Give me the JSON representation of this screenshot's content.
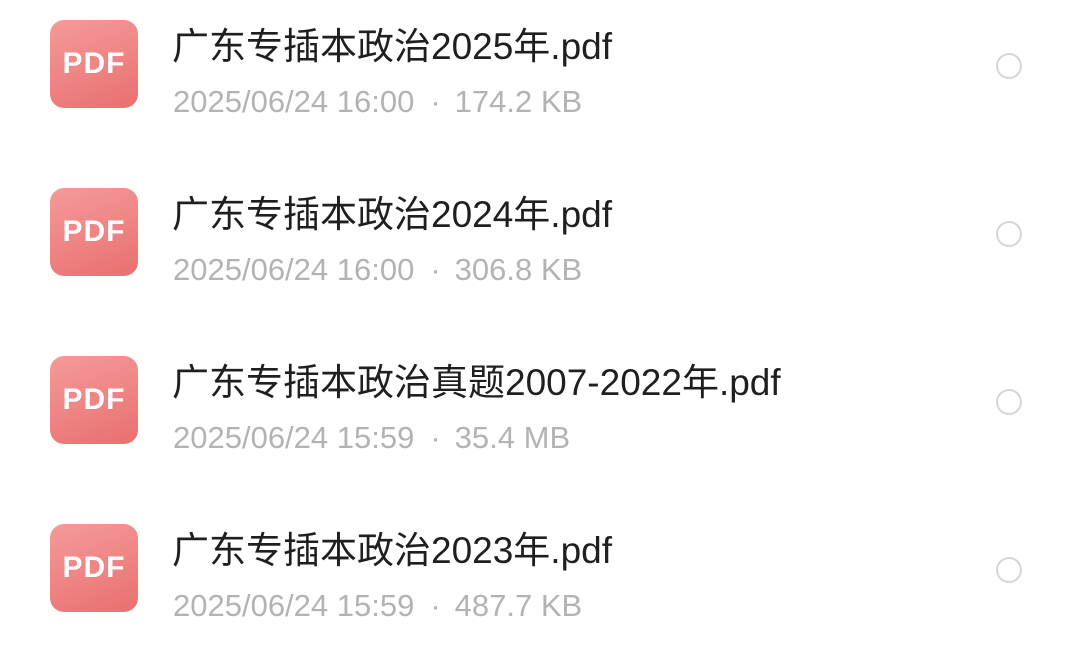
{
  "icon_badge": "PDF",
  "meta_separator": "·",
  "colors": {
    "pdf_icon": "#ef8383",
    "title_text": "#1f1f1f",
    "meta_text": "#b3b3b3",
    "radio_border": "#d6d6d6"
  },
  "files": [
    {
      "name": "广东专插本政治2025年.pdf",
      "date": "2025/06/24 16:00",
      "size": "174.2 KB",
      "icon": "pdf-file-icon",
      "selected": false
    },
    {
      "name": "广东专插本政治2024年.pdf",
      "date": "2025/06/24 16:00",
      "size": "306.8 KB",
      "icon": "pdf-file-icon",
      "selected": false
    },
    {
      "name": "广东专插本政治真题2007-2022年.pdf",
      "date": "2025/06/24 15:59",
      "size": "35.4 MB",
      "icon": "pdf-file-icon",
      "selected": false
    },
    {
      "name": "广东专插本政治2023年.pdf",
      "date": "2025/06/24 15:59",
      "size": "487.7 KB",
      "icon": "pdf-file-icon",
      "selected": false
    }
  ]
}
